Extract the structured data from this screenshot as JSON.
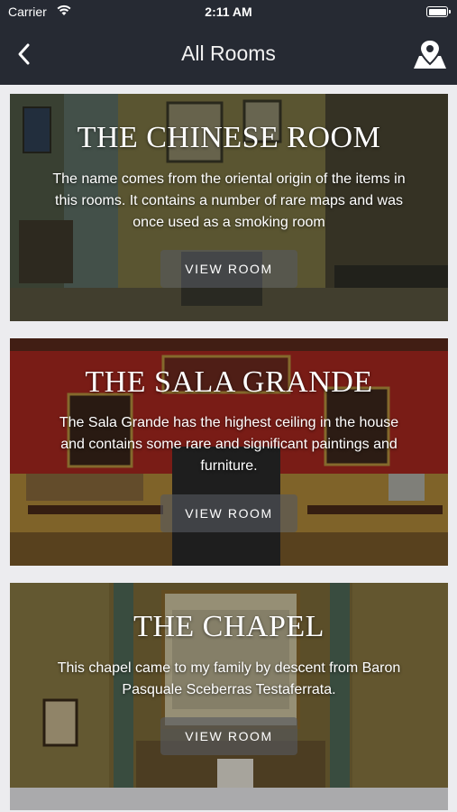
{
  "status_bar": {
    "carrier": "Carrier",
    "time": "2:11 AM"
  },
  "nav": {
    "title": "All Rooms",
    "back_icon": "chevron-left-icon",
    "map_icon": "map-pin-icon"
  },
  "rooms": [
    {
      "title": "THE CHINESE ROOM",
      "description": "The name comes from the oriental origin of the items in this rooms. It contains a number of rare maps and was once used as a smoking room",
      "button": "VIEW ROOM",
      "color": "#6b6a3c"
    },
    {
      "title": "THE SALA GRANDE",
      "description": "The Sala Grande has the highest ceiling in the house and contains some rare and significant paintings and furniture.",
      "button": "VIEW ROOM",
      "color": "#9e2a24"
    },
    {
      "title": "THE CHAPEL",
      "description": "This chapel came to my family by descent from Baron Pasquale Sceberras Testaferrata.",
      "button": "VIEW ROOM",
      "color": "#7a6a36"
    }
  ]
}
